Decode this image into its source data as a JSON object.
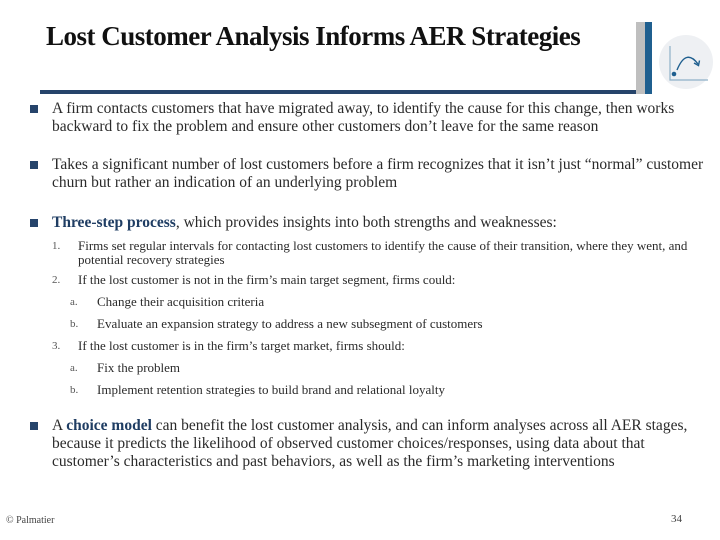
{
  "slide": {
    "title": "Lost Customer Analysis Informs AER Strategies",
    "logo_icon": "curve-arrow-chart-icon",
    "bullets": [
      {
        "text": "A firm contacts customers that have migrated away, to identify the cause for this change, then works backward to fix the problem and ensure other customers don’t leave for the same reason"
      },
      {
        "text": "Takes a significant number of lost customers before a firm recognizes that it isn’t just “normal” customer churn but rather an indication of an underlying problem"
      },
      {
        "highlight": "Three-step process",
        "text": ", which provides insights into both strengths and weaknesses:",
        "steps": [
          {
            "num": "1.",
            "text": "Firms set regular intervals for contacting lost customers to identify the cause of their transition, where they went, and potential recovery strategies"
          },
          {
            "num": "2.",
            "text": "If the lost customer is not in the firm’s main target segment, firms could:",
            "subs": [
              {
                "letter": "a.",
                "text": "Change their acquisition criteria"
              },
              {
                "letter": "b.",
                "text": "Evaluate an expansion strategy to address a new subsegment of customers"
              }
            ]
          },
          {
            "num": "3.",
            "text": "If the lost customer is in the firm’s target market, firms should:",
            "subs": [
              {
                "letter": "a.",
                "text": "Fix the problem"
              },
              {
                "letter": "b.",
                "text": "Implement retention strategies to build brand and relational loyalty"
              }
            ]
          }
        ]
      },
      {
        "prefix": "A ",
        "highlight": "choice model",
        "text": " can benefit the lost customer analysis, and can inform analyses across all AER stages, because it predicts the likelihood of observed customer choices/responses, using data about that customer’s characteristics and past behaviors, as well as the firm’s marketing interventions"
      }
    ],
    "footer_left": "© Palmatier",
    "page_number": "34"
  },
  "colors": {
    "accent": "#26446b",
    "side_blue": "#1f5f8f",
    "side_gray": "#bfbfbf"
  }
}
